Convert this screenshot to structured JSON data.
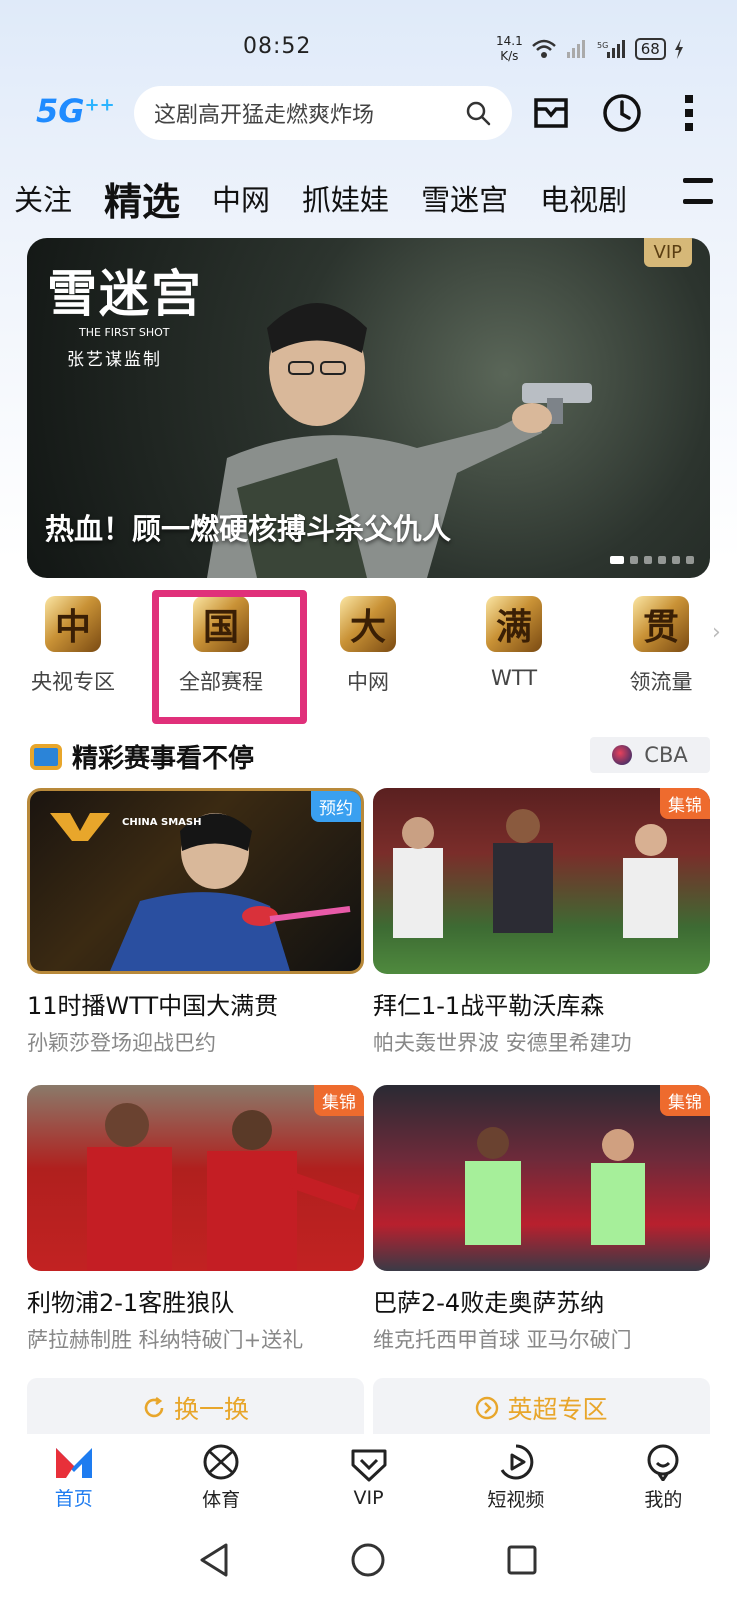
{
  "status_bar": {
    "time": "08:52",
    "net_speed_value": "14.1",
    "net_speed_unit": "K/s",
    "battery": "68"
  },
  "header": {
    "logo": "5G",
    "search_placeholder": "这剧高开猛走燃爽炸场",
    "icons": [
      "search-icon",
      "inbox-icon",
      "history-clock-icon",
      "more-vertical-icon"
    ]
  },
  "tabs": [
    {
      "label": "关注",
      "active": false
    },
    {
      "label": "精选",
      "active": true
    },
    {
      "label": "中网",
      "active": false
    },
    {
      "label": "抓娃娃",
      "active": false
    },
    {
      "label": "雪迷宫",
      "active": false
    },
    {
      "label": "电视剧",
      "active": false
    }
  ],
  "banner": {
    "logo_title": "雪迷宫",
    "logo_subtitle": "THE FIRST SHOT",
    "logo_director": "张艺谋监制",
    "badge": "VIP",
    "caption": "热血！顾一燃硬核搏斗杀父仇人",
    "slide_count": 6,
    "active_slide": 0
  },
  "categories": [
    {
      "icon_char": "中",
      "label": "央视专区"
    },
    {
      "icon_char": "国",
      "label": "全部赛程"
    },
    {
      "icon_char": "大",
      "label": "中网"
    },
    {
      "icon_char": "满",
      "label": "WTT"
    },
    {
      "icon_char": "贯",
      "label": "领流量"
    }
  ],
  "section": {
    "title": "精彩赛事看不停",
    "tag": "CBA"
  },
  "cards": [
    {
      "badge": "预约",
      "badge_color": "#3aa0f0",
      "thumb_text": "CHINA SMASH",
      "title": "11时播WTT中国大满贯",
      "subtitle": "孙颖莎登场迎战巴约"
    },
    {
      "badge": "集锦",
      "badge_color": "#ee6b2e",
      "thumb_text": "",
      "title": "拜仁1-1战平勒沃库森",
      "subtitle": "帕夫轰世界波 安德里希建功"
    },
    {
      "badge": "集锦",
      "badge_color": "#ee6b2e",
      "thumb_text": "",
      "title": "利物浦2-1客胜狼队",
      "subtitle": "萨拉赫制胜 科纳特破门+送礼"
    },
    {
      "badge": "集锦",
      "badge_color": "#ee6b2e",
      "thumb_text": "",
      "title": "巴萨2-4败走奥萨苏纳",
      "subtitle": "维克托西甲首球 亚马尔破门"
    }
  ],
  "actions": {
    "refresh": "换一换",
    "premier_league": "英超专区"
  },
  "bottom_nav": [
    {
      "label": "首页",
      "icon": "home-logo-icon",
      "active": true
    },
    {
      "label": "体育",
      "icon": "basketball-icon",
      "active": false
    },
    {
      "label": "VIP",
      "icon": "vip-shield-icon",
      "active": false
    },
    {
      "label": "短视频",
      "icon": "play-circle-icon",
      "active": false
    },
    {
      "label": "我的",
      "icon": "profile-icon",
      "active": false
    }
  ],
  "colors": {
    "accent": "#1e7cf0",
    "gold": "#e8a62b",
    "highlight": "#e0307a"
  }
}
